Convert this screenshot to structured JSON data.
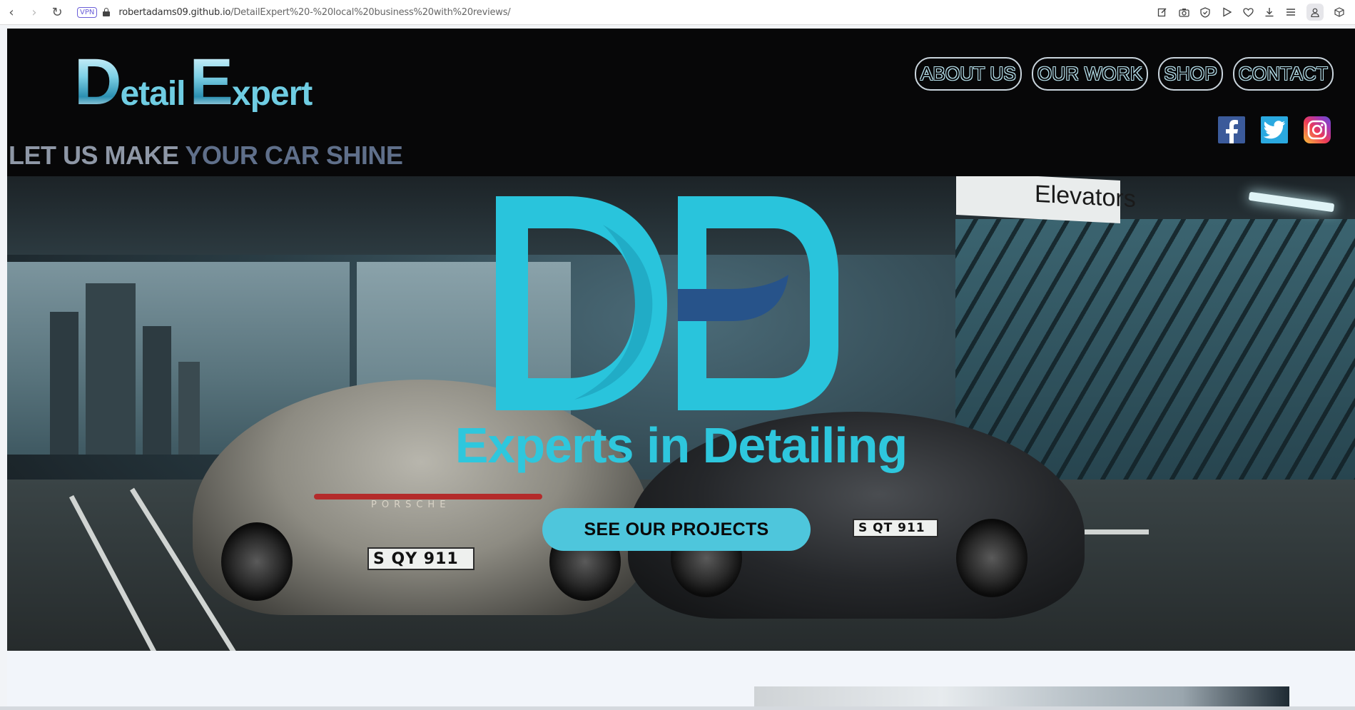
{
  "browser": {
    "back_icon": "‹",
    "forward_icon": "›",
    "reload_icon": "↻",
    "vpn_badge": "VPN",
    "url_host": "robertadams09.github.io",
    "url_path": "/DetailExpert%20-%20local%20business%20with%20reviews/",
    "toolbar_icons": [
      "edit-icon",
      "camera-icon",
      "shield-icon",
      "play-icon",
      "heart-icon",
      "download-icon",
      "menu-icon",
      "profile-icon",
      "box-icon"
    ]
  },
  "header": {
    "logo": {
      "d": "D",
      "etail": "etail",
      "e": "E",
      "xpert": "xpert"
    },
    "tagline_part1": "LET US MAKE ",
    "tagline_part2": "YOUR CAR SHINE",
    "nav": [
      "ABOUT US",
      "OUR WORK",
      "SHOP",
      "CONTACT"
    ],
    "socials": [
      "facebook-icon",
      "twitter-icon",
      "instagram-icon"
    ]
  },
  "hero": {
    "sign_text": "Elevators",
    "plate_left": "S QY 911",
    "plate_right": "S QT 911",
    "rear_badge": "PORSCHE",
    "title": "Experts in Detailing",
    "cta": "SEE OUR PROJECTS",
    "colors": {
      "accent": "#2ec7dd",
      "monogram_dark": "#27538a",
      "cta_bg": "#4ec6dc"
    }
  }
}
